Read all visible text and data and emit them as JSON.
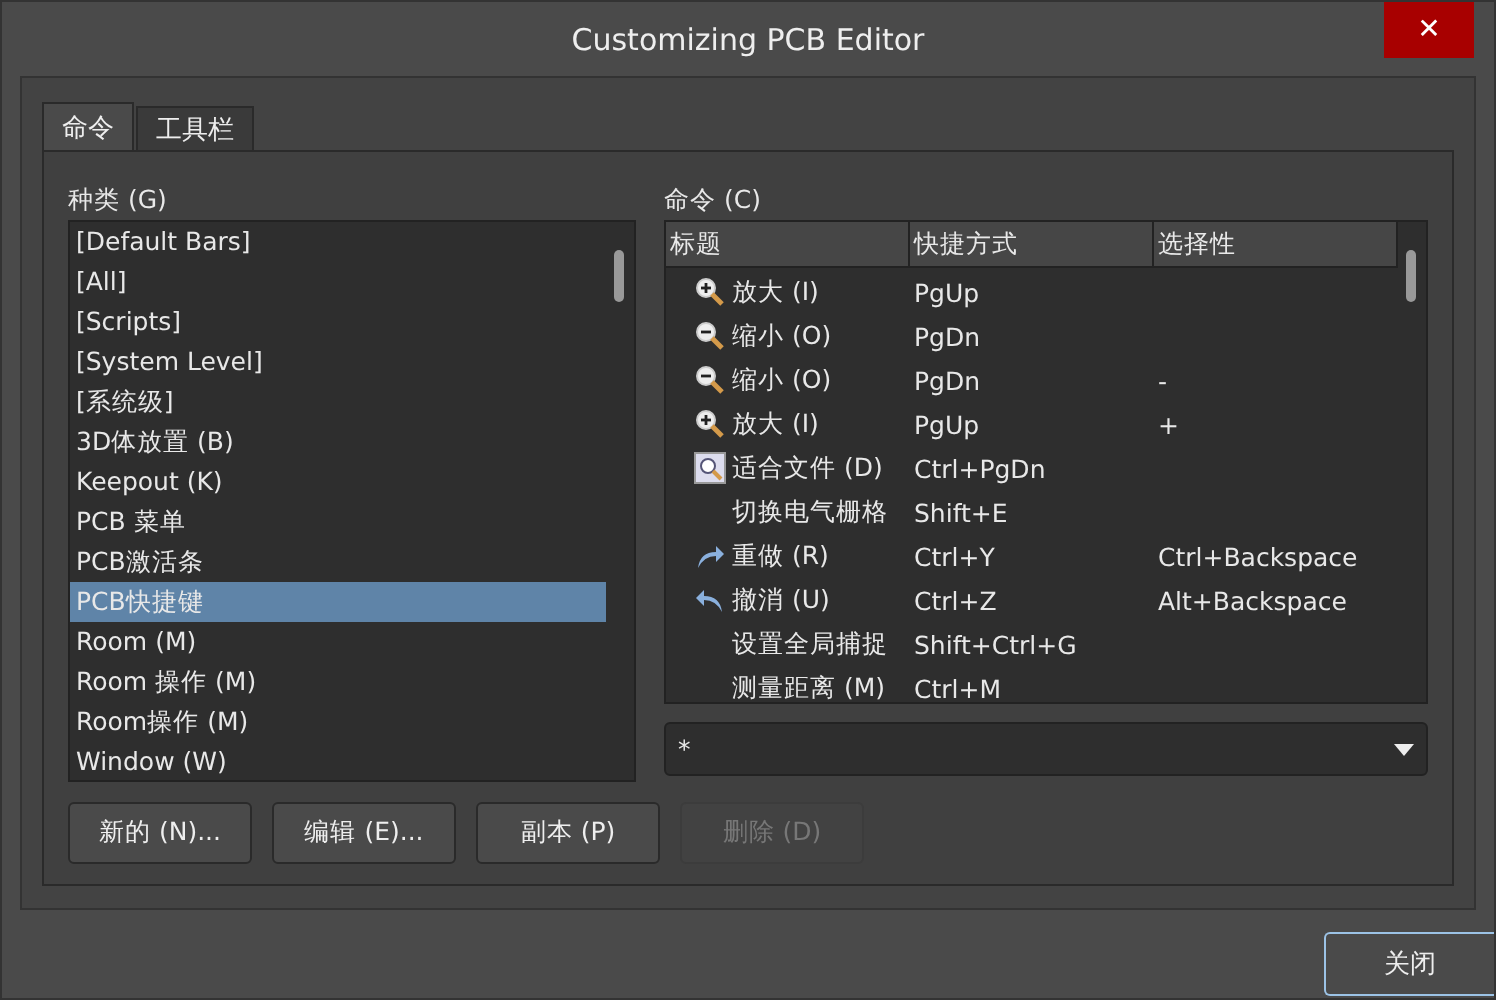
{
  "window": {
    "title": "Customizing PCB Editor",
    "close_glyph": "✕"
  },
  "tabs": [
    {
      "label": "命令",
      "selected": true
    },
    {
      "label": "工具栏",
      "selected": false
    }
  ],
  "categories": {
    "label": "种类 (G)",
    "items": [
      {
        "label": "[Default Bars]",
        "selected": false
      },
      {
        "label": "[All]",
        "selected": false
      },
      {
        "label": "[Scripts]",
        "selected": false
      },
      {
        "label": "[System Level]",
        "selected": false
      },
      {
        "label": "[系统级]",
        "selected": false
      },
      {
        "label": "3D体放置 (B)",
        "selected": false
      },
      {
        "label": "Keepout (K)",
        "selected": false
      },
      {
        "label": "PCB 菜单",
        "selected": false
      },
      {
        "label": "PCB激活条",
        "selected": false
      },
      {
        "label": "PCB快捷键",
        "selected": true
      },
      {
        "label": "Room (M)",
        "selected": false
      },
      {
        "label": "Room 操作 (M)",
        "selected": false
      },
      {
        "label": "Room操作 (M)",
        "selected": false
      },
      {
        "label": "Window (W)",
        "selected": false
      }
    ]
  },
  "commands": {
    "label": "命令 (C)",
    "columns": [
      "标题",
      "快捷方式",
      "选择性"
    ],
    "rows": [
      {
        "kind": "zoomin",
        "title": "放大 (I)",
        "shortcut": "PgUp"
      },
      {
        "kind": "zoomout",
        "title": "缩小 (O)",
        "shortcut": "PgDn"
      },
      {
        "kind": "zoomout",
        "title": "缩小 (O)",
        "shortcut": "PgDn",
        "selectivity": "-"
      },
      {
        "kind": "zoomin",
        "title": "放大 (I)",
        "shortcut": "PgUp",
        "selectivity": "+"
      },
      {
        "kind": "fit",
        "title": "适合文件 (D)",
        "shortcut": "Ctrl+PgDn"
      },
      {
        "kind": "plain",
        "title": "切换电气栅格",
        "shortcut": "Shift+E"
      },
      {
        "kind": "redo",
        "title": "重做 (R)",
        "shortcut": "Ctrl+Y",
        "selectivity": "Ctrl+Backspace"
      },
      {
        "kind": "undo",
        "title": "撤消 (U)",
        "shortcut": "Ctrl+Z",
        "selectivity": "Alt+Backspace"
      },
      {
        "kind": "plain",
        "title": "设置全局捕捉",
        "shortcut": "Shift+Ctrl+G"
      },
      {
        "kind": "plain",
        "title": "测量距离 (M)",
        "shortcut": "Ctrl+M"
      }
    ]
  },
  "filter": {
    "value": "*"
  },
  "buttons": [
    {
      "label": "新的 (N)...",
      "disabled": false
    },
    {
      "label": "编辑 (E)...",
      "disabled": false
    },
    {
      "label": "副本 (P)",
      "disabled": false
    },
    {
      "label": "删除 (D)",
      "disabled": true
    }
  ],
  "close_button": {
    "label": "关闭"
  }
}
